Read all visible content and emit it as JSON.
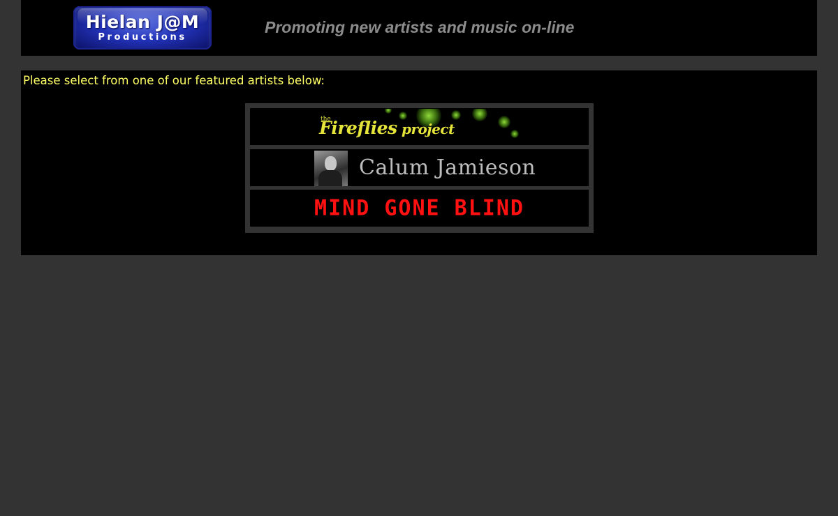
{
  "header": {
    "logo_line1": "Hielan J@M",
    "logo_line2": "Productions",
    "tagline": "Promoting new artists and music on-line"
  },
  "main": {
    "intro": "Please select from one of our featured artists below:",
    "artists": [
      {
        "the": "the",
        "name_main": "Fireflies",
        "name_rest": " project"
      },
      {
        "name": "Calum Jamieson"
      },
      {
        "name": "MIND GONE BLIND"
      }
    ]
  },
  "colors": {
    "page_background": "#333333",
    "panel_background": "#000000",
    "intro_text": "#ffff66",
    "tagline_text": "#8c8c8c",
    "fireflies_text": "#e4e43a",
    "calum_text": "#bdbdbd",
    "mgb_text": "#ff1111"
  }
}
